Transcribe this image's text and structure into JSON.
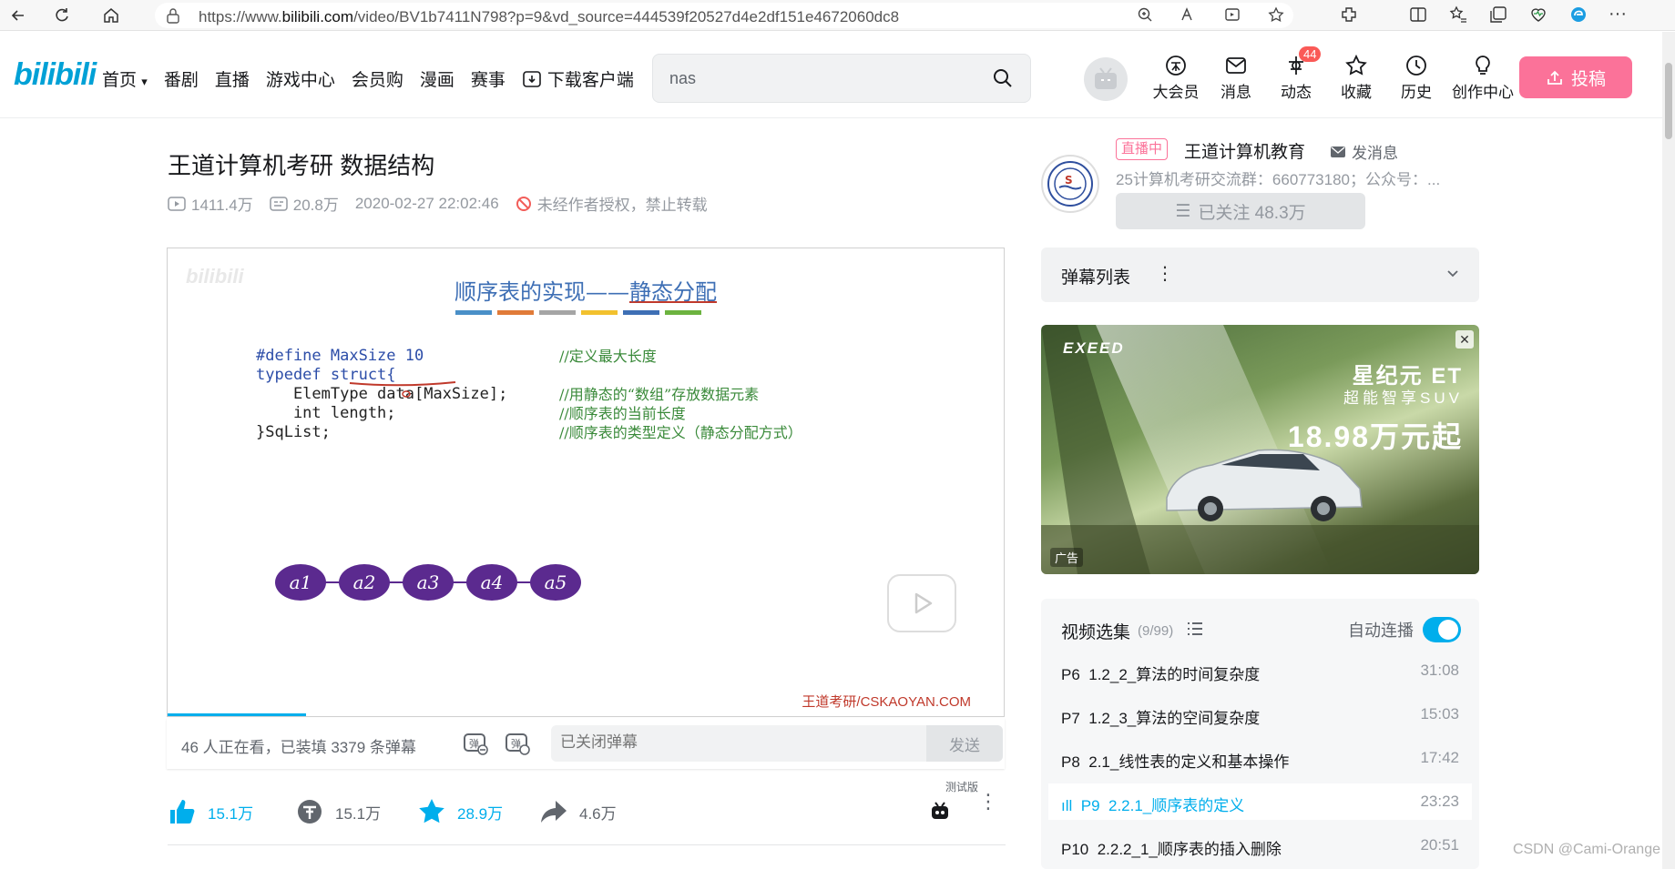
{
  "browser": {
    "url_prefix": "https://www.",
    "url_domain": "bilibili.com",
    "url_rest": "/video/BV1b7411N798?p=9&vd_source=444539f20527d4e2df151e4672060dc8"
  },
  "header": {
    "nav": [
      "首页",
      "番剧",
      "直播",
      "游戏中心",
      "会员购",
      "漫画",
      "赛事",
      "下载客户端"
    ],
    "search_value": "nas",
    "icons": [
      {
        "label": "大会员",
        "icon": "vip-icon"
      },
      {
        "label": "消息",
        "icon": "message-icon"
      },
      {
        "label": "动态",
        "icon": "dynamic-icon",
        "badge": "44"
      },
      {
        "label": "收藏",
        "icon": "star-icon"
      },
      {
        "label": "历史",
        "icon": "clock-icon"
      },
      {
        "label": "创作中心",
        "icon": "bulb-icon"
      }
    ],
    "upload_label": "投稿"
  },
  "video": {
    "title": "王道计算机考研 数据结构",
    "views": "1411.4万",
    "danmaku_count": "20.8万",
    "date": "2020-02-27 22:02:46",
    "copyright": "未经作者授权，禁止转载"
  },
  "slide": {
    "title_a": "顺序表的实现——",
    "title_b": "静态分配",
    "code_lines": [
      "#define MaxSize 10",
      "typedef struct{",
      "    ElemType data[MaxSize];",
      "    int length;",
      "}SqList;"
    ],
    "comments": [
      "//定义最大长度",
      "",
      "//用静态的“数组”存放数据元素",
      "//顺序表的当前长度",
      "//顺序表的类型定义（静态分配方式）"
    ],
    "elements": [
      "a1",
      "a2",
      "a3",
      "a4",
      "a5"
    ],
    "watermark": "王道考研/CSKAOYAN.COM"
  },
  "danmaku_bar": {
    "info": "46 人正在看，已装填 3379 条弹幕",
    "placeholder": "已关闭弹幕",
    "send": "发送"
  },
  "actions": {
    "like": "15.1万",
    "coin": "15.1万",
    "fav": "28.9万",
    "share": "4.6万",
    "test_label": "测试版"
  },
  "uploader": {
    "live": "直播中",
    "name": "王道计算机教育",
    "message": "发消息",
    "desc": "25计算机考研交流群：660773180；公众号：...",
    "follow": "已关注 48.3万"
  },
  "danmaku_list": {
    "title": "弹幕列表"
  },
  "ad": {
    "brand": "EXEED",
    "line1": "星纪元 ET",
    "line2": "超能智享SUV",
    "line3": "18.98万元起",
    "tag": "广告"
  },
  "episodes": {
    "title": "视频选集",
    "count": "(9/99)",
    "autoplay": "自动连播",
    "items": [
      {
        "num": "P6",
        "name": "1.2_2_算法的时间复杂度",
        "dur": "31:08"
      },
      {
        "num": "P7",
        "name": "1.2_3_算法的空间复杂度",
        "dur": "15:03"
      },
      {
        "num": "P8",
        "name": "2.1_线性表的定义和基本操作",
        "dur": "17:42"
      },
      {
        "num": "P9",
        "name": "2.2.1_顺序表的定义",
        "dur": "23:23",
        "active": true
      },
      {
        "num": "P10",
        "name": "2.2.2_1_顺序表的插入删除",
        "dur": "20:51"
      }
    ]
  },
  "csdn_mark": "CSDN @Cami-Orange",
  "colors": {
    "accent": "#00aeec",
    "pink": "#fb7299",
    "slide_blue": "#3e6fb5",
    "oval": "#5b2a8f"
  }
}
